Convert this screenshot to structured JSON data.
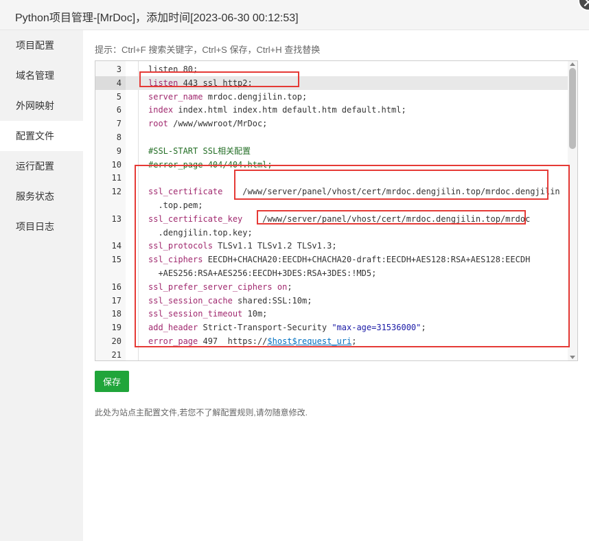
{
  "window": {
    "title": "Python项目管理-[MrDoc]，添加时间[2023-06-30 00:12:53]"
  },
  "sidebar": {
    "items": [
      {
        "label": "项目配置"
      },
      {
        "label": "域名管理"
      },
      {
        "label": "外网映射"
      },
      {
        "label": "配置文件",
        "active": true
      },
      {
        "label": "运行配置"
      },
      {
        "label": "服务状态"
      },
      {
        "label": "项目日志"
      }
    ]
  },
  "hint": "提示：Ctrl+F 搜索关键字，Ctrl+S 保存，Ctrl+H 查找替换",
  "editor": {
    "active_line": "4",
    "lines": [
      {
        "n": "3",
        "p": [
          {
            "t": "listen 80;"
          }
        ]
      },
      {
        "n": "4",
        "p": [
          {
            "t": "listen",
            "c": "k"
          },
          {
            "t": " 443 ssl http2;"
          }
        ]
      },
      {
        "n": "5",
        "p": [
          {
            "t": "server_name",
            "c": "k"
          },
          {
            "t": " mrdoc.dengjilin.top;"
          }
        ]
      },
      {
        "n": "6",
        "p": [
          {
            "t": "index",
            "c": "k"
          },
          {
            "t": " index.html index.htm default.htm default.html;"
          }
        ]
      },
      {
        "n": "7",
        "p": [
          {
            "t": "root",
            "c": "k"
          },
          {
            "t": " /www/wwwroot/MrDoc;"
          }
        ]
      },
      {
        "n": "8",
        "p": []
      },
      {
        "n": "9",
        "p": [
          {
            "t": "#SSL-START SSL相关配置",
            "c": "c"
          }
        ]
      },
      {
        "n": "10",
        "p": [
          {
            "t": "#error_page 404/404.html;",
            "c": "c"
          }
        ]
      },
      {
        "n": "11",
        "p": []
      },
      {
        "n": "12",
        "p": [
          {
            "t": "ssl_certificate",
            "c": "k"
          },
          {
            "t": "    /www/server/panel/vhost/cert/mrdoc.dengjilin.top/mrdoc.dengjilin"
          }
        ]
      },
      {
        "n": "",
        "p": [
          {
            "t": "  .top.pem;"
          }
        ]
      },
      {
        "n": "13",
        "p": [
          {
            "t": "ssl_certificate_key",
            "c": "k"
          },
          {
            "t": "    /www/server/panel/vhost/cert/mrdoc.dengjilin.top/mrdoc"
          }
        ]
      },
      {
        "n": "",
        "p": [
          {
            "t": "  .dengjilin.top.key;"
          }
        ]
      },
      {
        "n": "14",
        "p": [
          {
            "t": "ssl_protocols",
            "c": "k"
          },
          {
            "t": " TLSv1.1 TLSv1.2 TLSv1.3;"
          }
        ]
      },
      {
        "n": "15",
        "p": [
          {
            "t": "ssl_ciphers",
            "c": "k"
          },
          {
            "t": " EECDH+CHACHA20:EECDH+CHACHA20-draft:EECDH+AES128:RSA+AES128:EECDH"
          }
        ]
      },
      {
        "n": "",
        "p": [
          {
            "t": "  +AES256:RSA+AES256:EECDH+3DES:RSA+3DES:!MD5;"
          }
        ]
      },
      {
        "n": "16",
        "p": [
          {
            "t": "ssl_prefer_server_ciphers",
            "c": "k"
          },
          {
            "t": " "
          },
          {
            "t": "on",
            "c": "k"
          },
          {
            "t": ";"
          }
        ]
      },
      {
        "n": "17",
        "p": [
          {
            "t": "ssl_session_cache",
            "c": "k"
          },
          {
            "t": " shared:SSL:10m;"
          }
        ]
      },
      {
        "n": "18",
        "p": [
          {
            "t": "ssl_session_timeout",
            "c": "k"
          },
          {
            "t": " 10m;"
          }
        ]
      },
      {
        "n": "19",
        "p": [
          {
            "t": "add_header",
            "c": "k"
          },
          {
            "t": " Strict-Transport-Security "
          },
          {
            "t": "\"max-age=31536000\"",
            "c": "s"
          },
          {
            "t": ";"
          }
        ]
      },
      {
        "n": "20",
        "p": [
          {
            "t": "error_page",
            "c": "k"
          },
          {
            "t": " 497  https://"
          },
          {
            "t": "$host$request_uri",
            "c": "v"
          },
          {
            "t": ";"
          }
        ]
      },
      {
        "n": "21",
        "p": []
      }
    ]
  },
  "save_label": "保存",
  "note": "此处为站点主配置文件,若您不了解配置规则,请勿随意修改."
}
